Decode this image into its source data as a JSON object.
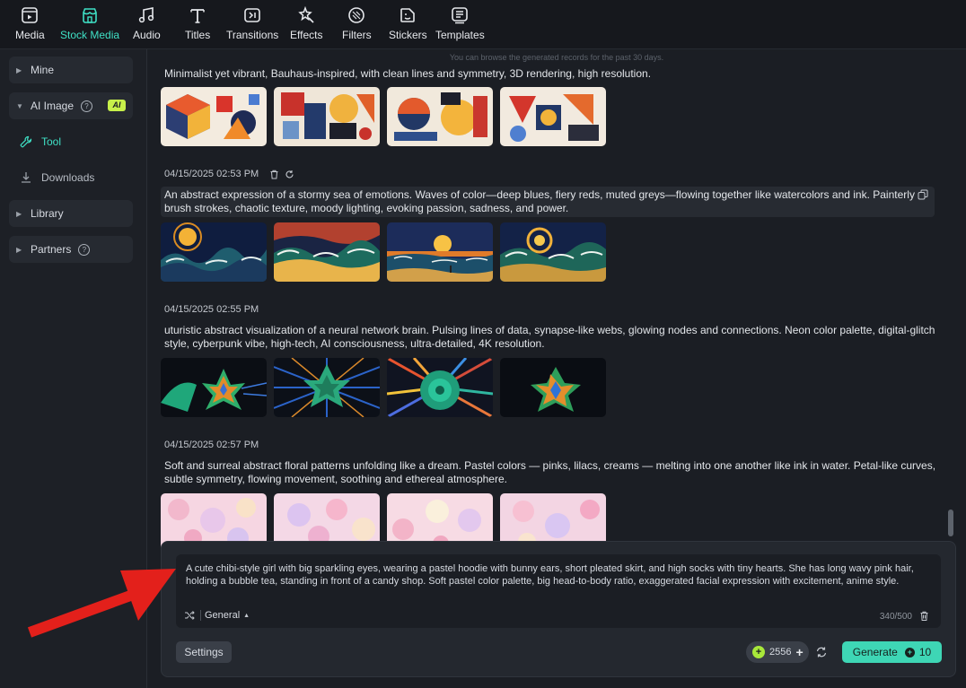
{
  "toolbar": {
    "tabs": [
      {
        "label": "Media",
        "icon": "media-icon"
      },
      {
        "label": "Stock Media",
        "icon": "stock-media-icon",
        "active": true
      },
      {
        "label": "Audio",
        "icon": "music-note-icon"
      },
      {
        "label": "Titles",
        "icon": "titles-icon"
      },
      {
        "label": "Transitions",
        "icon": "transitions-icon"
      },
      {
        "label": "Effects",
        "icon": "effects-icon"
      },
      {
        "label": "Filters",
        "icon": "filters-icon"
      },
      {
        "label": "Stickers",
        "icon": "stickers-icon"
      },
      {
        "label": "Templates",
        "icon": "templates-icon"
      }
    ]
  },
  "sidebar": {
    "mine": "Mine",
    "ai_image": "AI Image",
    "ai_badge": "AI",
    "tool": "Tool",
    "downloads": "Downloads",
    "library": "Library",
    "partners": "Partners"
  },
  "main": {
    "hint": "You can browse the generated records for the past 30 days.",
    "records": [
      {
        "timestamp": "",
        "prompt": "Minimalist yet vibrant, Bauhaus-inspired, with clean lines and symmetry, 3D rendering, high resolution.",
        "theme": "bauhaus"
      },
      {
        "timestamp": "04/15/2025 02:53 PM",
        "prompt": "An abstract expression of a stormy sea of emotions. Waves of color—deep blues, fiery reds, muted greys—flowing together like watercolors and ink. Painterly brush strokes, chaotic texture, moody lighting, evoking passion, sadness, and power.",
        "theme": "sea"
      },
      {
        "timestamp": "04/15/2025 02:55 PM",
        "prompt": "uturistic abstract visualization of a neural network brain. Pulsing lines of data, synapse-like webs, glowing nodes and connections. Neon color palette, digital-glitch style, cyberpunk vibe, high-tech, AI consciousness, ultra-detailed, 4K resolution.",
        "theme": "neural"
      },
      {
        "timestamp": "04/15/2025 02:57 PM",
        "prompt": "Soft and surreal abstract floral patterns unfolding like a dream. Pastel colors — pinks, lilacs, creams — melting into one another like ink in water. Petal-like curves, subtle symmetry, flowing movement, soothing and ethereal atmosphere.",
        "theme": "floral"
      }
    ]
  },
  "composer": {
    "prompt": "A cute chibi-style girl with big sparkling eyes, wearing a pastel hoodie with bunny ears, short pleated skirt, and high socks with tiny hearts. She has long wavy pink hair, holding a bubble tea, standing in front of a candy shop. Soft pastel color palette, big head-to-body ratio, exaggerated facial expression with excitement, anime style.",
    "style": "General",
    "counter": "340/500",
    "settings": "Settings",
    "credits": "2556",
    "generate": "Generate",
    "cost": "10"
  },
  "colors": {
    "accent": "#3fe0c5",
    "generate": "#3ed6b5",
    "ai_badge": "#c7f04a",
    "arrow": "#e3201b"
  }
}
